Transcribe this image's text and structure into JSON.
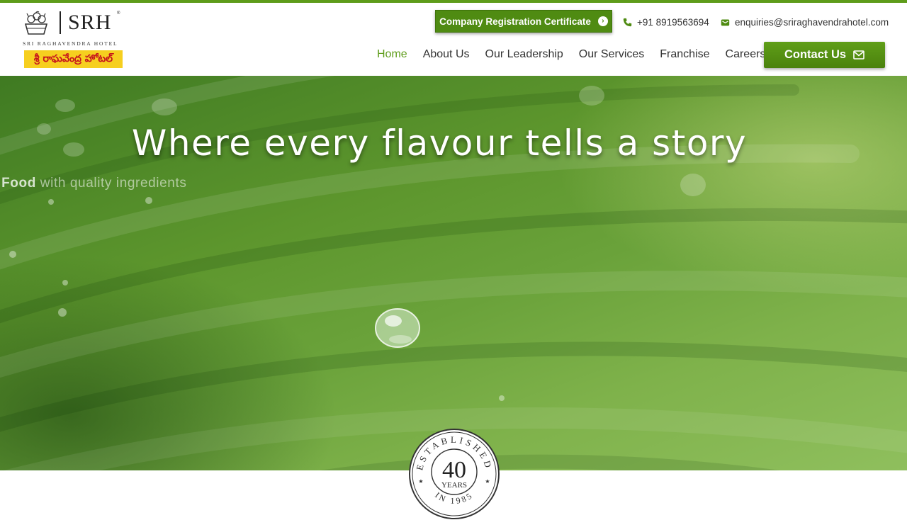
{
  "brand": {
    "name": "SRH",
    "registered_mark": "®",
    "subtitle": "SRI RAGHAVENDRA HOTEL",
    "local_name": "శ్రీ రాఘవేంద్ర హోటల్"
  },
  "topbar": {
    "cert_button_label": "Company Registration Certificate",
    "phone": "+91 8919563694",
    "email": "enquiries@sriraghavendrahotel.com"
  },
  "nav": {
    "items": [
      {
        "label": "Home",
        "active": true
      },
      {
        "label": "About Us"
      },
      {
        "label": "Our Leadership"
      },
      {
        "label": "Our Services"
      },
      {
        "label": "Franchise"
      },
      {
        "label": "Careers"
      }
    ],
    "contact_button_label": "Contact Us"
  },
  "hero": {
    "title": "Where every flavour tells a story",
    "subtitle_bold": "n Food",
    "subtitle_rest": " with quality ingredients"
  },
  "badge": {
    "top_text": "ESTABLISHED",
    "number": "40",
    "unit": "YEARS",
    "bottom_text": "IN 1985"
  },
  "colors": {
    "accent": "#5e9c1a",
    "button_green": "#4f8b12",
    "telugu_badge_bg": "#f6cf1f",
    "telugu_text": "#c6121c"
  }
}
